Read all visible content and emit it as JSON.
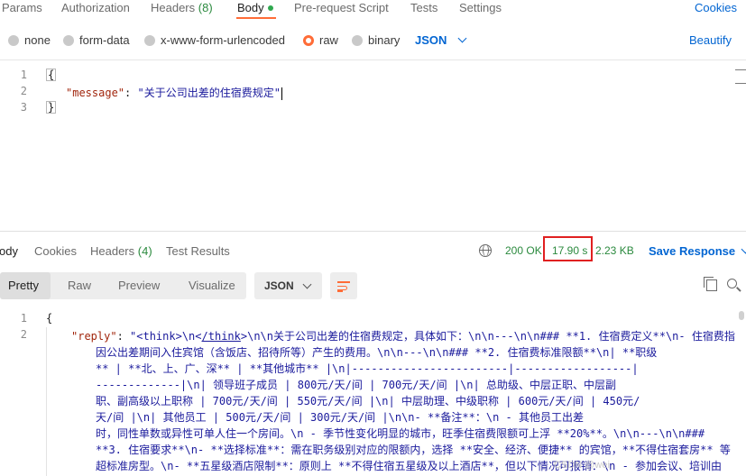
{
  "request_tabs": [
    {
      "label": "Params"
    },
    {
      "label": "Authorization"
    },
    {
      "label": "Headers",
      "count": "(8)"
    },
    {
      "label": "Body"
    },
    {
      "label": "Pre-request Script"
    },
    {
      "label": "Tests"
    },
    {
      "label": "Settings"
    }
  ],
  "cookies_link": "Cookies",
  "body_types": [
    {
      "label": "none"
    },
    {
      "label": "form-data"
    },
    {
      "label": "x-www-form-urlencoded"
    },
    {
      "label": "raw",
      "selected": true
    },
    {
      "label": "binary"
    }
  ],
  "body_format": "JSON",
  "beautify_label": "Beautify",
  "request_editor": {
    "line_numbers": [
      "1",
      "2",
      "3"
    ],
    "open_brace": "{",
    "key": "\"message\"",
    "colon": ": ",
    "value": "\"关于公司出差的住宿费规定\"",
    "close_brace": "}"
  },
  "response_tabs": [
    {
      "label": "ody"
    },
    {
      "label": "Cookies"
    },
    {
      "label": "Headers",
      "count": "(4)"
    },
    {
      "label": "Test Results"
    }
  ],
  "response_meta": {
    "status": "200 OK",
    "time": "17.90 s",
    "size": "2.23 KB",
    "save_label": "Save Response"
  },
  "view_modes": [
    {
      "label": "Pretty"
    },
    {
      "label": "Raw"
    },
    {
      "label": "Preview"
    },
    {
      "label": "Visualize"
    }
  ],
  "response_format": "JSON",
  "response_editor": {
    "line_numbers": [
      "1",
      "2"
    ],
    "open_brace": "{",
    "key": "\"reply\"",
    "colon": ": ",
    "first_line_value": "\"<think>\\n<",
    "think_close": "/think",
    "first_line_rest": ">\\n\\n关于公司出差的住宿费规定，具体如下：\\n\\n---\\n\\n### **1. 住宿费定义**\\n- 住宿费指",
    "wrapped_lines": [
      "因公出差期间入住宾馆（含饭店、招待所等）产生的费用。\\n\\n---\\n\\n### **2. 住宿费标准限额**\\n| **职级",
      "**              | **北、上、广、深** | **其他城市** |\\n|------------------------|------------------|",
      "-------------|\\n| 领导班子成员          | 800元/天/间      | 700元/天/间 |\\n| 总助级、中层正职、中层副",
      "职、副高级以上职称 | 700元/天/间      | 550元/天/间 |\\n| 中层助理、中级职称     | 600元/天/间      | 450元/",
      "天/间 |\\n| 其他员工                | 500元/天/间      | 300元/天/间 |\\n\\n- **备注**：\\n  - 其他员工出差",
      "时，同性单数或异性可单人住一个房间。\\n  - 季节性变化明显的城市，旺季住宿费限额可上浮 **20%**。\\n\\n---\\n\\n###",
      "**3. 住宿要求**\\n- **选择标准**：需在职务级别对应的限额内，选择 **安全、经济、便捷** 的宾馆，**不得住宿套房** 等",
      "超标准房型。\\n- **五星级酒店限制**：原则上 **不得住宿五星级及以上酒店**，但以下情况可报销：\\n  - 参加会议、培训由"
    ]
  },
  "watermark": "CSDN @wei"
}
